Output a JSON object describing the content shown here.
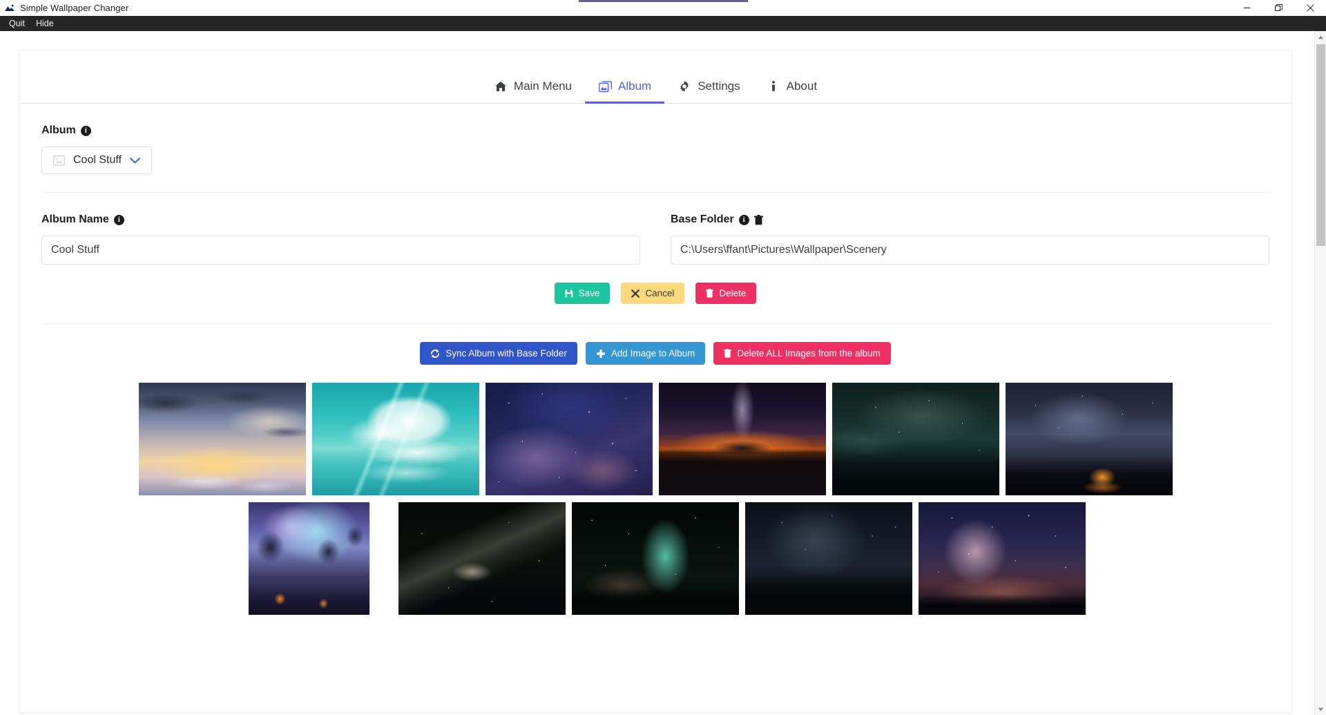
{
  "window": {
    "title": "Simple Wallpaper Changer",
    "app_icon": "mountain-photo-icon",
    "controls": {
      "minimize": "minimize-icon",
      "restore": "restore-icon",
      "close": "close-icon"
    }
  },
  "menubar": {
    "items": [
      {
        "label": "Quit",
        "name": "menu-item-quit"
      },
      {
        "label": "Hide",
        "name": "menu-item-hide"
      }
    ]
  },
  "tabs": [
    {
      "label": "Main Menu",
      "icon": "home-icon",
      "active": false
    },
    {
      "label": "Album",
      "icon": "images-icon",
      "active": true
    },
    {
      "label": "Settings",
      "icon": "gear-icon",
      "active": false
    },
    {
      "label": "About",
      "icon": "info-icon",
      "active": false
    }
  ],
  "album_section": {
    "label": "Album",
    "info_glyph": "i",
    "selected_album": "Cool Stuff",
    "select_icon": "image-placeholder-icon",
    "chevron": "chevron-down-icon"
  },
  "album_name_field": {
    "label": "Album Name",
    "info_glyph": "i",
    "value": "Cool Stuff",
    "placeholder": "Album Name"
  },
  "base_folder_field": {
    "label": "Base Folder",
    "info_glyph": "i",
    "trash_icon": "trash-icon",
    "value": "C:\\Users\\ffant\\Pictures\\Wallpaper\\Scenery",
    "placeholder": "Base Folder"
  },
  "crud_buttons": [
    {
      "label": "Save",
      "icon": "save-disk-icon",
      "color": "#1bc5a0",
      "class": "btn-save",
      "name": "save-button"
    },
    {
      "label": "Cancel",
      "icon": "x-icon",
      "color": "#fbd97c",
      "class": "btn-cancel",
      "name": "cancel-button"
    },
    {
      "label": "Delete",
      "icon": "trash-icon",
      "color": "#ed2f63",
      "class": "btn-delete",
      "name": "delete-button"
    }
  ],
  "action_buttons": [
    {
      "label": "Sync Album with Base Folder",
      "icon": "sync-icon",
      "color": "#2f55c8",
      "class": "btn-sync",
      "name": "sync-album-button"
    },
    {
      "label": "Add Image to Album",
      "icon": "plus-icon",
      "color": "#3596d4",
      "class": "btn-add",
      "name": "add-image-button"
    },
    {
      "label": "Delete ALL Images from the album",
      "icon": "trash-icon",
      "color": "#ed2f63",
      "class": "btn-delall",
      "name": "delete-all-images-button"
    }
  ],
  "gallery": {
    "thumbnails": [
      {
        "name": "thumbnail-sunset-clouds",
        "art": "art-sunsetclouds",
        "orientation": "landscape"
      },
      {
        "name": "thumbnail-big-cloud-pier",
        "art": "art-bigcloud",
        "orientation": "landscape"
      },
      {
        "name": "thumbnail-blue-nebula",
        "art": "art-nebulablue",
        "orientation": "landscape"
      },
      {
        "name": "thumbnail-volcano-milkyway",
        "art": "art-volcano",
        "orientation": "landscape"
      },
      {
        "name": "thumbnail-dark-shore",
        "art": "art-darkshore",
        "orientation": "landscape"
      },
      {
        "name": "thumbnail-lake-campfire",
        "art": "art-lakecampfire",
        "orientation": "landscape"
      },
      {
        "name": "thumbnail-fantasy-aurora",
        "art": "art-fantasyaurora",
        "orientation": "portrait"
      },
      {
        "name": "thumbnail-faint-milkyway",
        "art": "art-milkyfaint",
        "orientation": "landscape"
      },
      {
        "name": "thumbnail-green-milkyway",
        "art": "art-greenmilky",
        "orientation": "landscape"
      },
      {
        "name": "thumbnail-forest-night-sky",
        "art": "art-forestnight",
        "orientation": "landscape"
      },
      {
        "name": "thumbnail-milkyway-core",
        "art": "art-milkycore",
        "orientation": "landscape"
      }
    ]
  },
  "scrollbar": {
    "up_arrow": "caret-up-icon",
    "down_arrow": "caret-down-icon"
  }
}
